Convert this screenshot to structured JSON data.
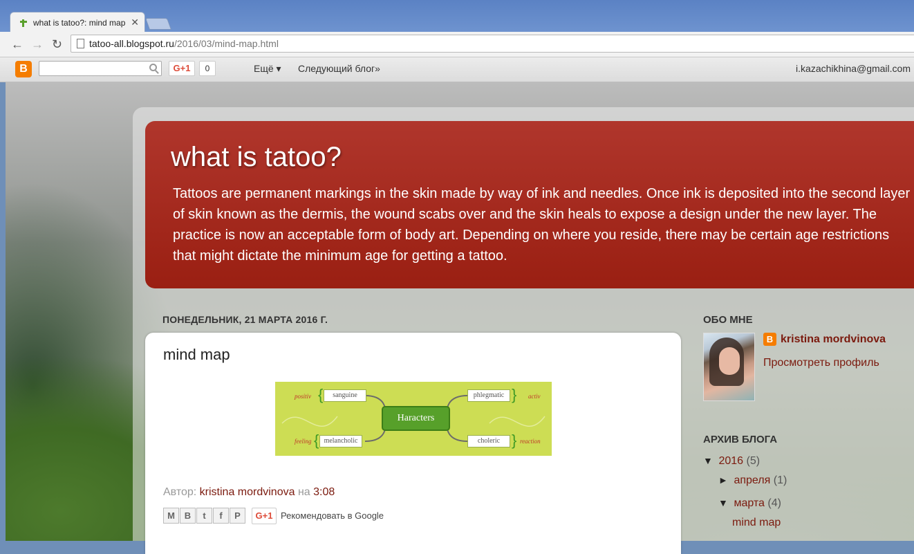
{
  "browser": {
    "tab_title": "what is tatoo?: mind map",
    "tab_close": "✕",
    "url_host": "tatoo-all.blogspot.ru",
    "url_path": "/2016/03/mind-map.html",
    "back": "←",
    "forward": "→",
    "reload": "↻"
  },
  "navbar": {
    "logo": "B",
    "gplus_label": "G+1",
    "gplus_count": "0",
    "more": "Ещё ▾",
    "next_blog": "Следующий блог»",
    "email": "i.kazachikhina@gmail.com"
  },
  "header": {
    "title": "what is tatoo?",
    "description": "Tattoos are permanent markings in the skin made by way of ink and needles. Once ink is deposited into the second layer of skin known as the dermis, the wound scabs over and the skin heals to expose a design under the new layer. The practice is now an acceptable form of body art. Depending on where you reside, there may be certain age restrictions that might dictate the minimum age for getting a tattoo."
  },
  "post": {
    "date": "ПОНЕДЕЛЬНИК, 21 МАРТА 2016 Г.",
    "title": "mind map",
    "mindmap": {
      "center": "Haracters",
      "nodes": [
        "sanguine",
        "phlegmatic",
        "melancholic",
        "choleric"
      ],
      "sides": [
        "positiv",
        "activ",
        "feeling",
        "reaction"
      ]
    },
    "author_prefix": "Автор:",
    "author": "kristina mordvinova",
    "on": "на",
    "time": "3:08",
    "share_buttons": [
      "M",
      "B",
      "t",
      "f",
      "P"
    ],
    "gplus_label": "G+1",
    "recommend": "Рекомендовать в Google"
  },
  "sidebar": {
    "about_heading": "ОБО МНЕ",
    "profile_name": "kristina mordvinova",
    "profile_link": "Просмотреть профиль",
    "archive_heading": "АРХИВ БЛОГА",
    "archive": [
      {
        "toggle": "▼",
        "label": "2016",
        "count": "(5)"
      },
      {
        "toggle": "►",
        "label": "апреля",
        "count": "(1)"
      },
      {
        "toggle": "▼",
        "label": "марта",
        "count": "(4)"
      },
      {
        "toggle": "",
        "label": "mind map",
        "count": ""
      }
    ]
  },
  "colors": {
    "header_red": "#a42a1e",
    "link": "#7b1a0e",
    "blogger_orange": "#f57d00"
  }
}
